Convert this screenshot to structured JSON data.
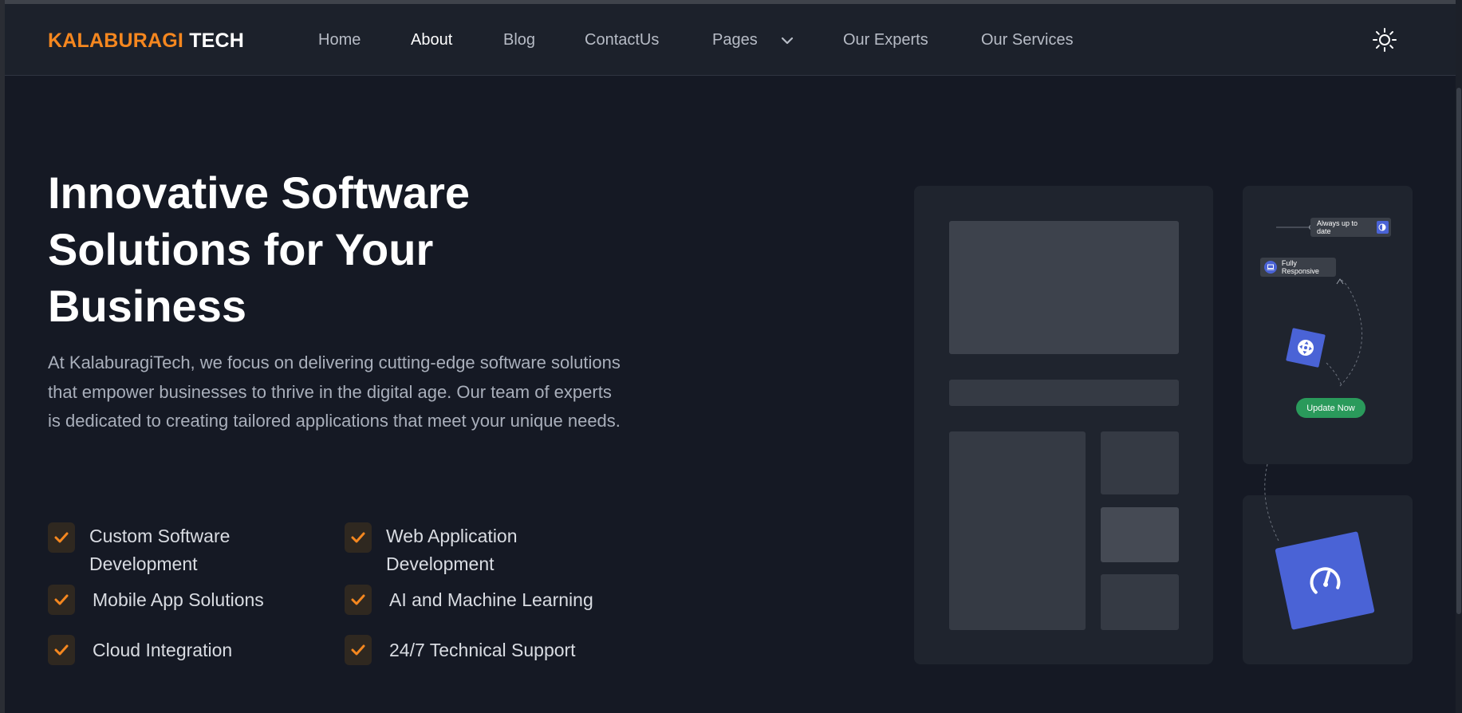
{
  "header": {
    "logo_primary": "KALABURAGI",
    "logo_secondary": "TECH",
    "nav": [
      {
        "label": "Home"
      },
      {
        "label": "About"
      },
      {
        "label": "Blog"
      },
      {
        "label": "ContactUs"
      },
      {
        "label": "Pages"
      },
      {
        "label": "Our Experts"
      },
      {
        "label": "Our Services"
      }
    ],
    "active_nav": "About",
    "theme_icon": "sun-icon",
    "pages_dropdown_icon": "chevron-down-icon"
  },
  "hero": {
    "title": "Innovative Software Solutions for Your Business",
    "description": "At KalaburagiTech, we focus on delivering cutting-edge software solutions that empower businesses to thrive in the digital age. Our team of experts is dedicated to creating tailored applications that meet your unique needs.",
    "features": [
      {
        "label": "Custom Software Development"
      },
      {
        "label": "Web Application Development"
      },
      {
        "label": "Mobile App Solutions"
      },
      {
        "label": "AI and Machine Learning"
      },
      {
        "label": "Cloud Integration"
      },
      {
        "label": "24/7 Technical Support"
      }
    ],
    "feature_icon": "check-icon"
  },
  "illustration": {
    "tag_always": "Always up to date",
    "tag_responsive": "Fully Responsive",
    "update_button": "Update Now",
    "tile_small_icon": "move-arrows-icon",
    "tile_big_icon": "speedometer-icon"
  },
  "colors": {
    "accent": "#f5871f",
    "background": "#151924",
    "header_bg": "#1c212b",
    "blue": "#4a63d6",
    "green": "#2a9a5b"
  }
}
